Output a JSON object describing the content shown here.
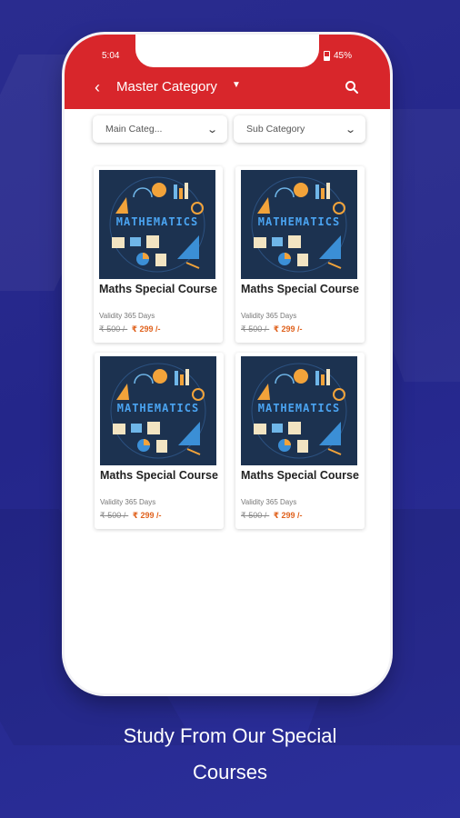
{
  "status_bar": {
    "time": "5:04",
    "battery": "45%"
  },
  "app_bar": {
    "title": "Master Category"
  },
  "filters": {
    "main_category": "Main Categ...",
    "sub_category": "Sub Category"
  },
  "courses": [
    {
      "title": "Maths Special Course",
      "validity": "Validity 365 Days",
      "old_price": "₹ 500 /-",
      "new_price": "₹ 299 /-",
      "image_text": "MATHEMATICS"
    },
    {
      "title": "Maths Special Course",
      "validity": "Validity 365 Days",
      "old_price": "₹ 500 /-",
      "new_price": "₹ 299 /-",
      "image_text": "MATHEMATICS"
    },
    {
      "title": "Maths Special Course",
      "validity": "Validity 365 Days",
      "old_price": "₹ 500 /-",
      "new_price": "₹ 299 /-",
      "image_text": "MATHEMATICS"
    },
    {
      "title": "Maths Special Course",
      "validity": "Validity 365 Days",
      "old_price": "₹ 500 /-",
      "new_price": "₹ 299 /-",
      "image_text": "MATHEMATICS"
    }
  ],
  "footer": {
    "line1": "Study From Our Special",
    "line2": "Courses"
  },
  "colors": {
    "accent": "#d8262b",
    "price": "#e0631f",
    "background": "#2a2c8f",
    "thumbnail": "#1c3250"
  },
  "icons": [
    "back-arrow-icon",
    "dropdown-caret-icon",
    "search-icon",
    "chevron-down-icon",
    "battery-icon"
  ]
}
